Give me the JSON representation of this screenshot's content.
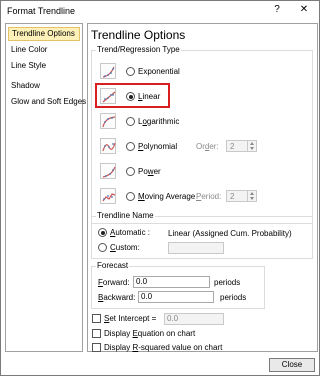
{
  "window": {
    "title": "Format Trendline",
    "help_glyph": "?",
    "close_glyph": "✕"
  },
  "sidebar": {
    "items": [
      {
        "label": "Trendline Options",
        "active": true
      },
      {
        "label": "Line Color"
      },
      {
        "label": "Line Style"
      },
      {
        "label": "Shadow"
      },
      {
        "label": "Glow and Soft Edges"
      }
    ]
  },
  "panel": {
    "title": "Trendline Options",
    "type_group": {
      "label": "Trend/Regression Type",
      "options": [
        {
          "label": "Exponential",
          "icon": "exponential-trend-icon",
          "selected": false
        },
        {
          "label": "Linear",
          "icon": "linear-trend-icon",
          "selected": true
        },
        {
          "label": "Logarithmic",
          "icon": "logarithmic-trend-icon",
          "selected": false
        },
        {
          "label": "Polynomial",
          "icon": "polynomial-trend-icon",
          "selected": false
        },
        {
          "label": "Power",
          "icon": "power-trend-icon",
          "selected": false
        },
        {
          "label": "Moving Average",
          "icon": "moving-average-trend-icon",
          "selected": false
        }
      ],
      "order_label": "Order:",
      "order_value": "2",
      "period_label": "Period:",
      "period_value": "2"
    },
    "name_group": {
      "label": "Trendline Name",
      "automatic_label": "Automatic :",
      "automatic_value": "Linear (Assigned Cum. Probability)",
      "custom_label": "Custom:",
      "custom_value": ""
    },
    "forecast_group": {
      "label": "Forecast",
      "forward_label": "Forward:",
      "forward_value": "0.0",
      "forward_unit": "periods",
      "backward_label": "Backward:",
      "backward_value": "0.0",
      "backward_unit": "periods"
    },
    "set_intercept_label": "Set Intercept =",
    "set_intercept_value": "0.0",
    "display_equation_label": "Display Equation on chart",
    "display_rsquared_label": "Display R-squared value on chart"
  },
  "footer": {
    "close_label": "Close"
  },
  "colors": {
    "highlight": "#d81e1e",
    "active_tab_bg": "#fdf0b8"
  }
}
